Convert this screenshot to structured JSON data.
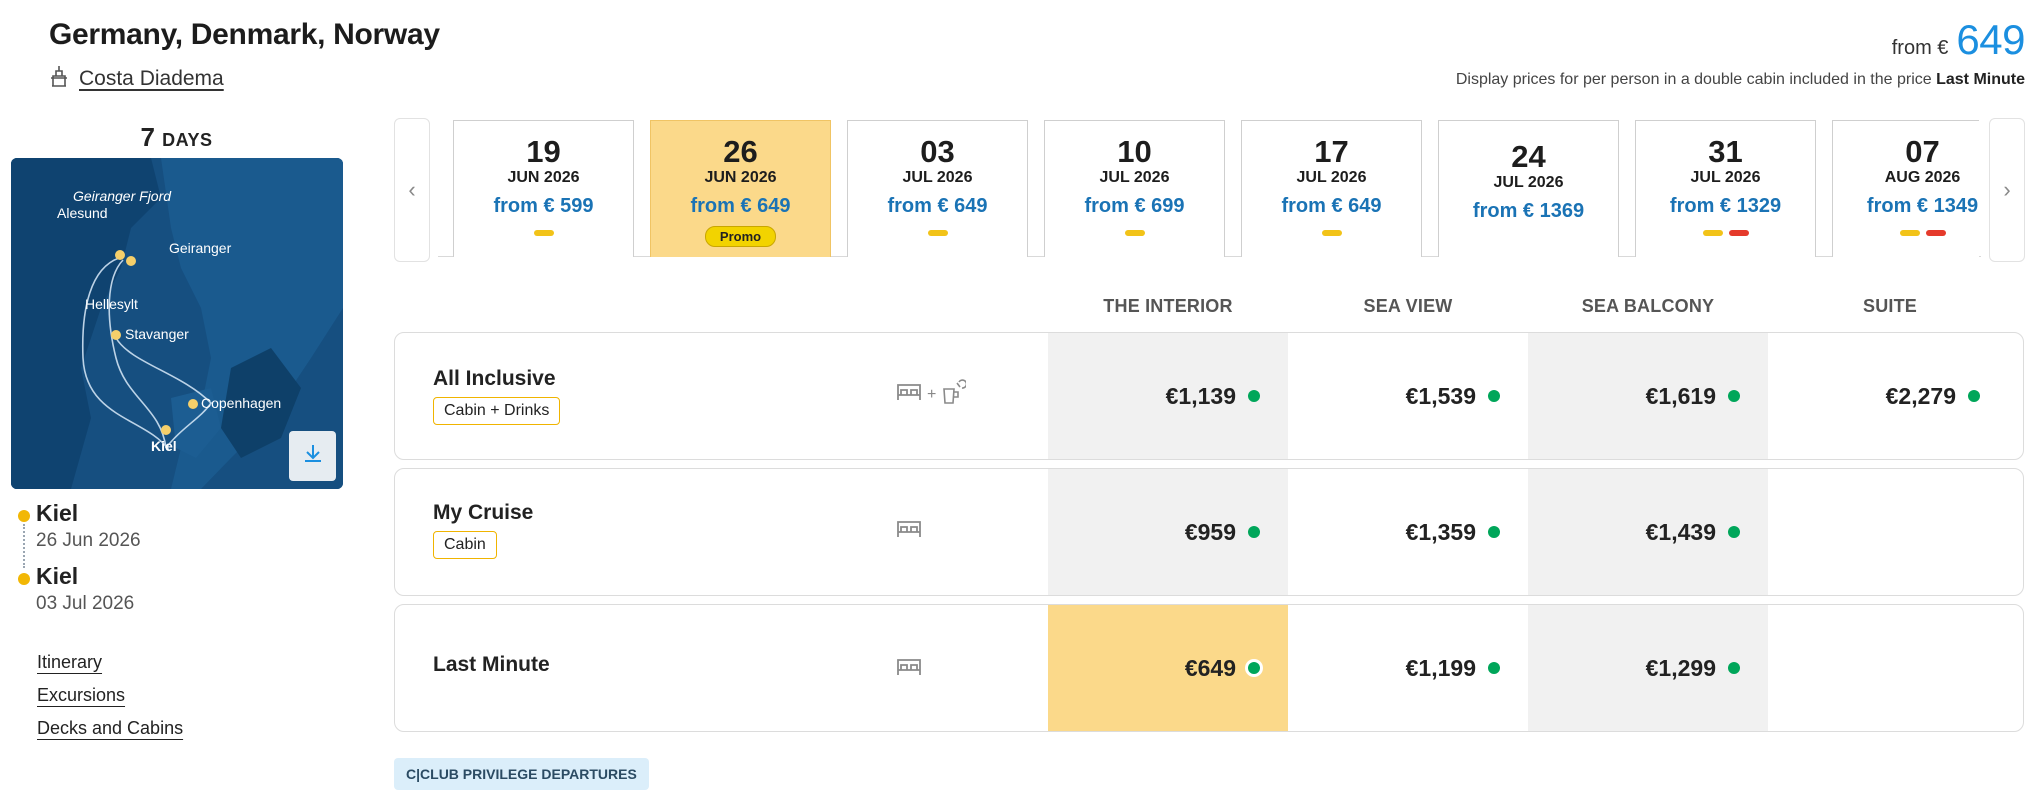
{
  "header": {
    "title": "Germany, Denmark, Norway",
    "ship_name": "Costa Diadema",
    "price_from_label": "from €",
    "price_from_amount": "649",
    "disclaimer_text": "Display prices for per person in a double cabin included in the price",
    "disclaimer_bold": "Last Minute"
  },
  "sidebar": {
    "days_number": "7",
    "days_label": "DAYS",
    "map_labels": {
      "geiranger_fjord": "Geiranger Fjord",
      "alesund": "Alesund",
      "geiranger": "Geiranger",
      "hellesylt": "Hellesylt",
      "stavanger": "Stavanger",
      "copenhagen": "Copenhagen",
      "kiel": "Kiel"
    },
    "route": [
      {
        "city": "Kiel",
        "date": "26 Jun 2026"
      },
      {
        "city": "Kiel",
        "date": "03 Jul 2026"
      }
    ],
    "links": [
      "Itinerary",
      "Excursions",
      "Decks and Cabins"
    ]
  },
  "dates": [
    {
      "day": "19",
      "month": "JUN 2026",
      "price": "from € 599",
      "bars": [
        "yellow"
      ],
      "active": false
    },
    {
      "day": "26",
      "month": "JUN 2026",
      "price": "from € 649",
      "bars": [],
      "active": true,
      "promo": "Promo"
    },
    {
      "day": "03",
      "month": "JUL 2026",
      "price": "from € 649",
      "bars": [
        "yellow"
      ],
      "active": false
    },
    {
      "day": "10",
      "month": "JUL 2026",
      "price": "from € 699",
      "bars": [
        "yellow"
      ],
      "active": false
    },
    {
      "day": "17",
      "month": "JUL 2026",
      "price": "from € 649",
      "bars": [
        "yellow"
      ],
      "active": false
    },
    {
      "day": "24",
      "month": "JUL 2026",
      "price": "from € 1369",
      "bars": [],
      "active": false
    },
    {
      "day": "31",
      "month": "JUL 2026",
      "price": "from € 1329",
      "bars": [
        "yellow",
        "red"
      ],
      "active": false
    },
    {
      "day": "07",
      "month": "AUG 2026",
      "price": "from € 1349",
      "bars": [
        "yellow",
        "red"
      ],
      "active": false
    }
  ],
  "columns": [
    "THE INTERIOR",
    "SEA VIEW",
    "SEA BALCONY",
    "SUITE"
  ],
  "rates": [
    {
      "name": "All Inclusive",
      "tag": "Cabin + Drinks",
      "icons": "bed-plus-drinks",
      "plus": "+",
      "prices": [
        "€1,139",
        "€1,539",
        "€1,619",
        "€2,279"
      ]
    },
    {
      "name": "My Cruise",
      "tag": "Cabin",
      "icons": "bed",
      "prices": [
        "€959",
        "€1,359",
        "€1,439",
        ""
      ]
    },
    {
      "name": "Last Minute",
      "tag": "",
      "icons": "bed",
      "prices": [
        "€649",
        "€1,199",
        "€1,299",
        ""
      ]
    }
  ],
  "club_badge": "C|CLUB PRIVILEGE DEPARTURES",
  "colors": {
    "accent_blue": "#1b8fe0",
    "price_blue": "#1a73b5",
    "highlight": "#fbd98a",
    "status_green": "#00a65a",
    "bar_yellow": "#f2c318",
    "bar_red": "#e53a2b"
  }
}
